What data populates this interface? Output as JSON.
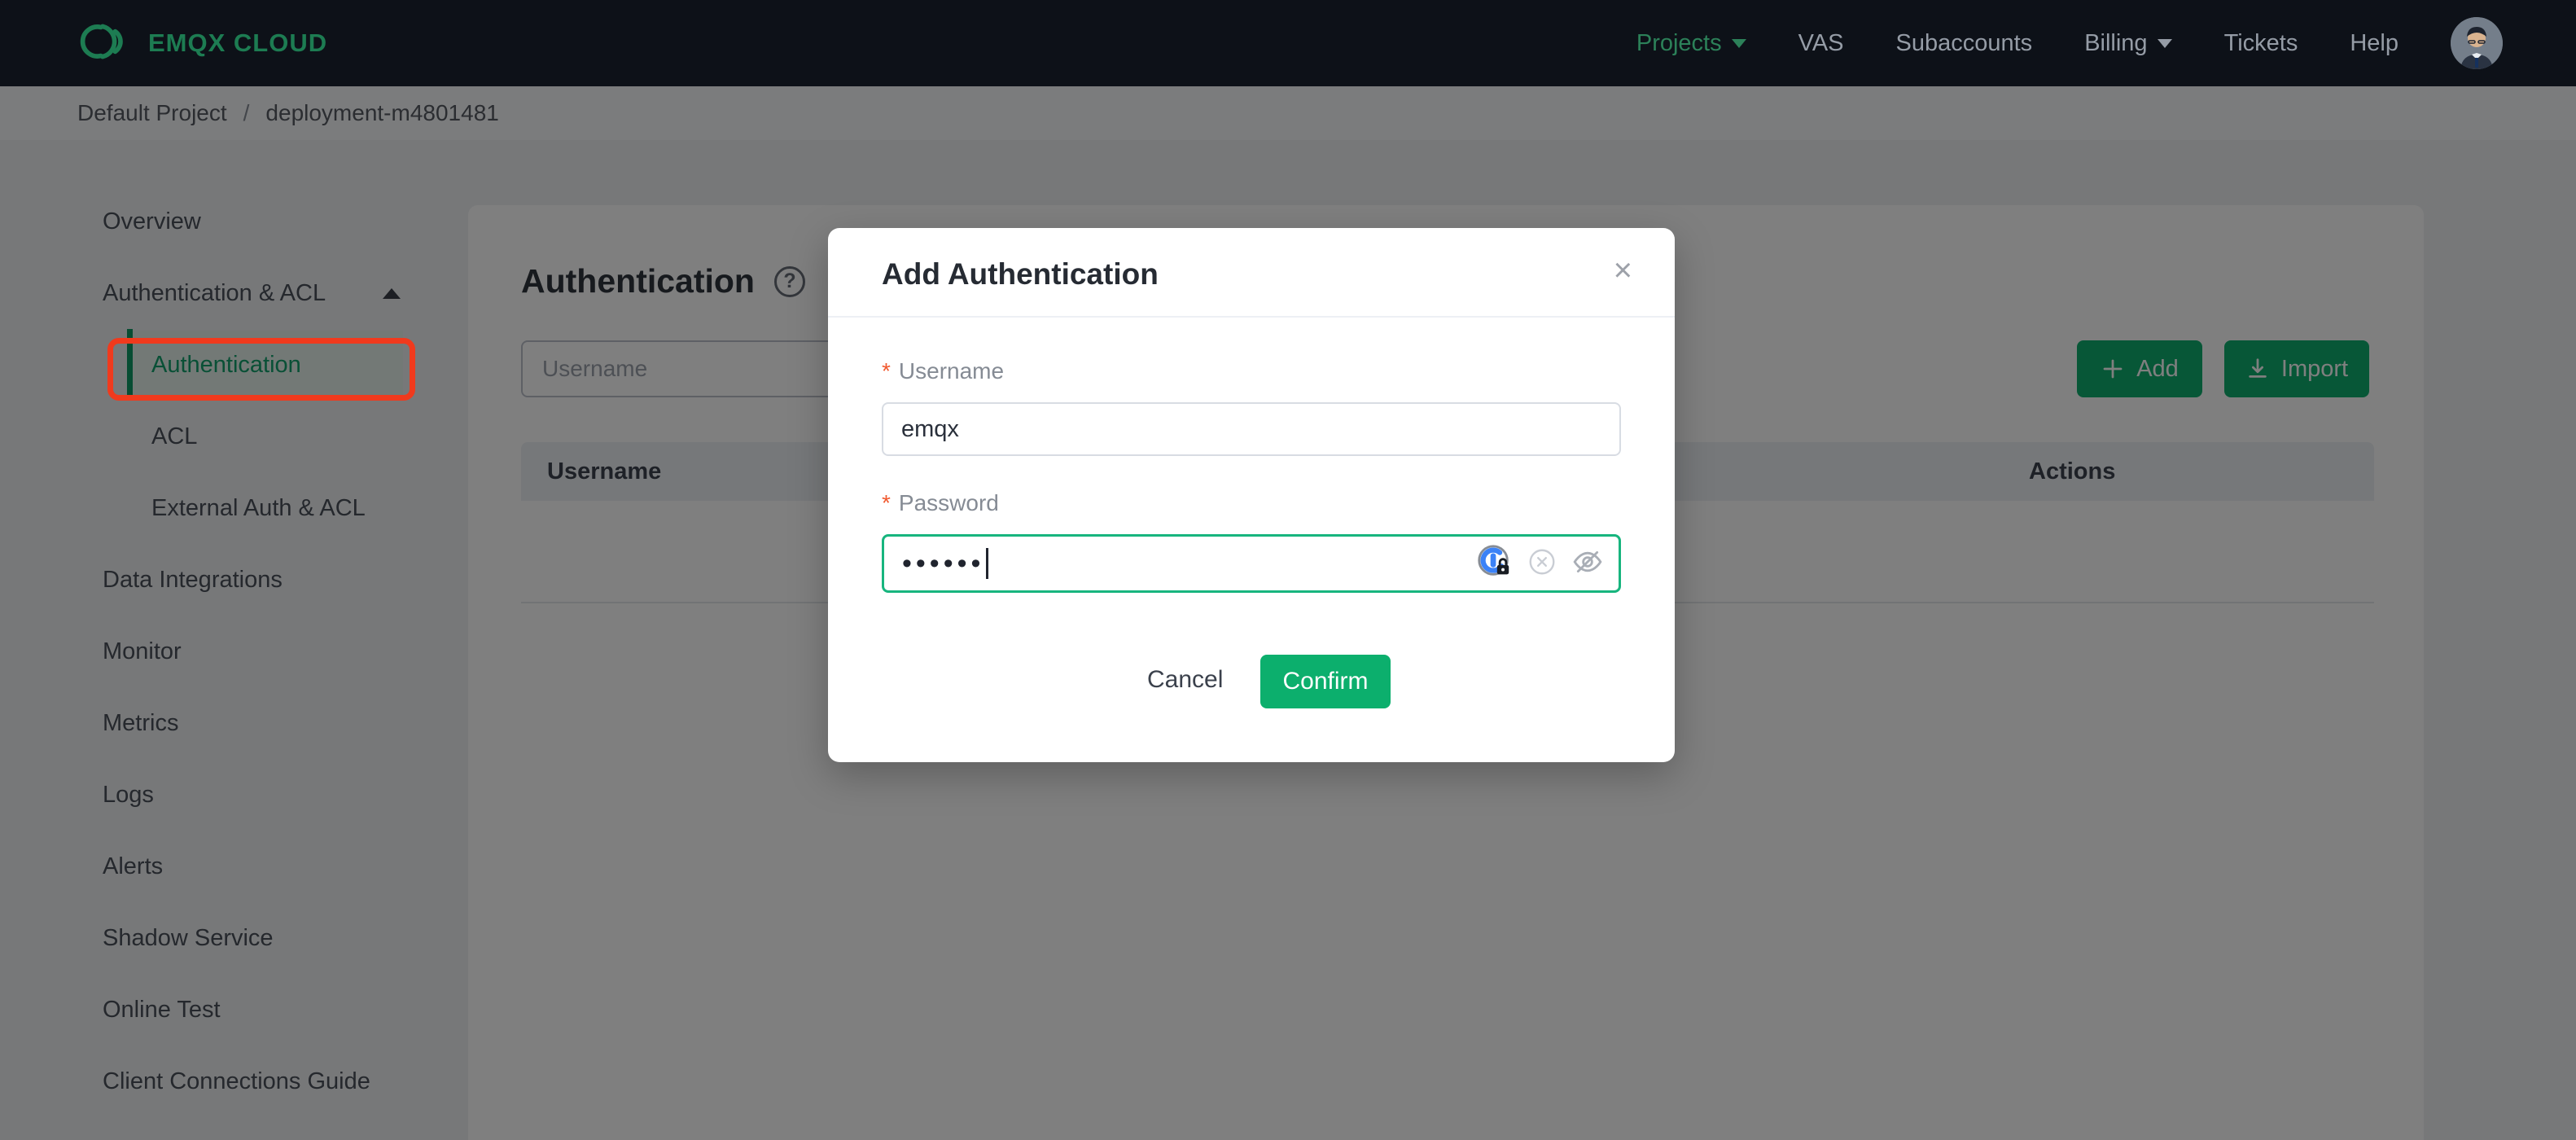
{
  "topbar": {
    "brand": "EMQX CLOUD",
    "nav": [
      {
        "label": "Projects",
        "caret": true,
        "active": true
      },
      {
        "label": "VAS",
        "caret": false,
        "active": false
      },
      {
        "label": "Subaccounts",
        "caret": false,
        "active": false
      },
      {
        "label": "Billing",
        "caret": true,
        "active": false
      },
      {
        "label": "Tickets",
        "caret": false,
        "active": false
      },
      {
        "label": "Help",
        "caret": false,
        "active": false
      }
    ]
  },
  "breadcrumb": {
    "project": "Default Project",
    "separator": "/",
    "deployment": "deployment-m4801481"
  },
  "sidebar": {
    "items": [
      {
        "label": "Overview"
      },
      {
        "label": "Authentication & ACL"
      },
      {
        "label": "Authentication",
        "active": true
      },
      {
        "label": "ACL"
      },
      {
        "label": "External Auth & ACL"
      },
      {
        "label": "Data Integrations"
      },
      {
        "label": "Monitor"
      },
      {
        "label": "Metrics"
      },
      {
        "label": "Logs"
      },
      {
        "label": "Alerts"
      },
      {
        "label": "Shadow Service"
      },
      {
        "label": "Online Test"
      },
      {
        "label": "Client Connections Guide"
      }
    ]
  },
  "main": {
    "title": "Authentication",
    "help_icon": "?",
    "search_placeholder": "Username",
    "add_label": "Add",
    "import_label": "Import",
    "table": {
      "col_username": "Username",
      "col_actions": "Actions"
    }
  },
  "modal": {
    "title": "Add Authentication",
    "close_glyph": "×",
    "required_marker": "*",
    "username_label": "Username",
    "username_value": "emqx",
    "password_label": "Password",
    "password_masked": "••••••",
    "cancel_label": "Cancel",
    "confirm_label": "Confirm"
  },
  "colors": {
    "accent_green": "#0caf6d",
    "topbar_bg": "#0d1118",
    "annotation_red": "#f03a1d",
    "password_focus_border": "#17b57e",
    "onepassword_blue": "#3b82f7"
  }
}
